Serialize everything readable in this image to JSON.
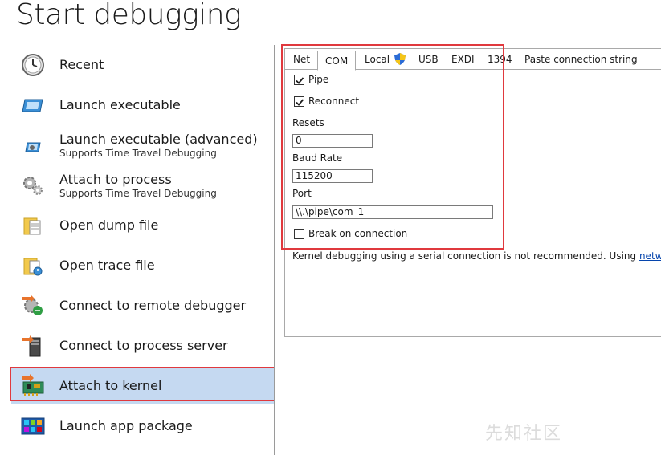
{
  "page": {
    "title": "Start debugging"
  },
  "sidebar": {
    "items": [
      {
        "label": "Recent",
        "sub": "",
        "icon": "clock-icon"
      },
      {
        "label": "Launch executable",
        "sub": "",
        "icon": "window-icon"
      },
      {
        "label": "Launch executable (advanced)",
        "sub": "Supports Time Travel Debugging",
        "icon": "gear-window-icon"
      },
      {
        "label": "Attach to process",
        "sub": "Supports Time Travel Debugging",
        "icon": "gears-icon"
      },
      {
        "label": "Open dump file",
        "sub": "",
        "icon": "folder-document-icon"
      },
      {
        "label": "Open trace file",
        "sub": "",
        "icon": "folder-trace-icon"
      },
      {
        "label": "Connect to remote debugger",
        "sub": "",
        "icon": "remote-connect-icon"
      },
      {
        "label": "Connect to process server",
        "sub": "",
        "icon": "server-icon"
      },
      {
        "label": "Attach to kernel",
        "sub": "",
        "icon": "circuit-board-icon",
        "selected": true
      },
      {
        "label": "Launch app package",
        "sub": "",
        "icon": "app-grid-icon"
      }
    ]
  },
  "tabs": [
    {
      "label": "Net"
    },
    {
      "label": "COM",
      "active": true
    },
    {
      "label": "Local",
      "icon": "uac-shield-icon"
    },
    {
      "label": "USB"
    },
    {
      "label": "EXDI"
    },
    {
      "label": "1394"
    },
    {
      "label": "Paste connection string"
    }
  ],
  "com": {
    "pipe": {
      "label": "Pipe",
      "checked": true
    },
    "reconnect": {
      "label": "Reconnect",
      "checked": true
    },
    "resets": {
      "label": "Resets",
      "value": "0"
    },
    "baud": {
      "label": "Baud Rate",
      "value": "115200"
    },
    "port": {
      "label": "Port",
      "value": "\\\\.\\pipe\\com_1"
    },
    "break_on_connection": {
      "label": "Break on connection",
      "checked": false
    }
  },
  "info": {
    "text": "Kernel debugging using a serial connection is not recommended. Using ",
    "link": "network"
  },
  "watermark": {
    "text": "先知社区"
  },
  "colors": {
    "highlight_red": "#e0393e",
    "selection_blue": "#c5d9f1",
    "link_blue": "#0645ad"
  }
}
